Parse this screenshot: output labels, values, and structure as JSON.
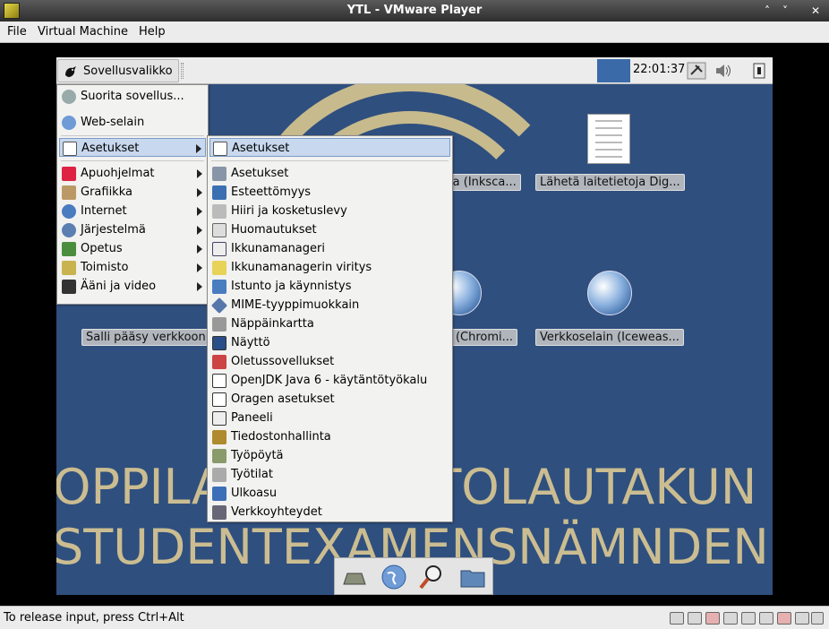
{
  "window": {
    "title": "YTL - VMware Player",
    "buttons": [
      "˄",
      "˅",
      "✕"
    ]
  },
  "menubar": [
    {
      "label": "File"
    },
    {
      "label": "Virtual Machine"
    },
    {
      "label": "Help"
    }
  ],
  "status": {
    "text": "To release input, press Ctrl+Alt"
  },
  "guest": {
    "app_menu_label": "Sovellusvalikko",
    "clock": "22:01:37",
    "background_lines": [
      "OPPILASTUTKINTOLAUTAKUN",
      "STUDENTEXAMENSNÄMNDEN"
    ],
    "desktop_icons": [
      {
        "label": "ma (Inksca..."
      },
      {
        "label": "Lähetä laitetietoja Dig..."
      },
      {
        "label": "Salli pääsy verkkoon"
      },
      {
        "label": "in (Chromi..."
      },
      {
        "label": "Verkkoselain (Iceweas..."
      }
    ],
    "colors": {
      "desktop": "#2f4f7e",
      "highlight": "#c8d8ee",
      "accent_text": "#cbbd91"
    }
  },
  "main_menu": [
    {
      "label": "Suorita sovellus...",
      "icon": "run-icon"
    },
    {
      "label": "Web-selain",
      "icon": "globe-icon"
    },
    {
      "label": "Asetukset",
      "icon": "settings-icon",
      "submenu": true
    },
    {
      "label": "Apuohjelmat",
      "icon": "accessories-icon",
      "submenu": true
    },
    {
      "label": "Grafiikka",
      "icon": "graphics-icon",
      "submenu": true
    },
    {
      "label": "Internet",
      "icon": "internet-icon",
      "submenu": true
    },
    {
      "label": "Järjestelmä",
      "icon": "system-icon",
      "submenu": true
    },
    {
      "label": "Opetus",
      "icon": "education-icon",
      "submenu": true
    },
    {
      "label": "Toimisto",
      "icon": "office-icon",
      "submenu": true
    },
    {
      "label": "Ääni ja video",
      "icon": "media-icon",
      "submenu": true
    }
  ],
  "sub_menu": [
    {
      "label": "Asetukset",
      "icon": "settings-icon"
    },
    {
      "label": "Asetukset",
      "icon": "tools-icon"
    },
    {
      "label": "Esteettömyys",
      "icon": "accessibility-icon"
    },
    {
      "label": "Hiiri ja kosketuslevy",
      "icon": "mouse-icon"
    },
    {
      "label": "Huomautukset",
      "icon": "notification-icon"
    },
    {
      "label": "Ikkunamanageri",
      "icon": "window-manager-icon"
    },
    {
      "label": "Ikkunamanagerin viritys",
      "icon": "window-tweaks-icon"
    },
    {
      "label": "Istunto ja käynnistys",
      "icon": "session-icon"
    },
    {
      "label": "MIME-tyyppimuokkain",
      "icon": "mime-icon"
    },
    {
      "label": "Näppäinkartta",
      "icon": "keyboard-icon"
    },
    {
      "label": "Näyttö",
      "icon": "display-icon"
    },
    {
      "label": "Oletussovellukset",
      "icon": "default-apps-icon"
    },
    {
      "label": "OpenJDK Java 6 - käytäntötyökalu",
      "icon": "java-icon"
    },
    {
      "label": "Oragen asetukset",
      "icon": "calendar-icon"
    },
    {
      "label": "Paneeli",
      "icon": "panel-icon"
    },
    {
      "label": "Tiedostonhallinta",
      "icon": "file-manager-icon"
    },
    {
      "label": "Työpöytä",
      "icon": "desktop-icon"
    },
    {
      "label": "Työtilat",
      "icon": "workspaces-icon"
    },
    {
      "label": "Ulkoasu",
      "icon": "appearance-icon"
    },
    {
      "label": "Verkkoyhteydet",
      "icon": "network-icon"
    }
  ]
}
